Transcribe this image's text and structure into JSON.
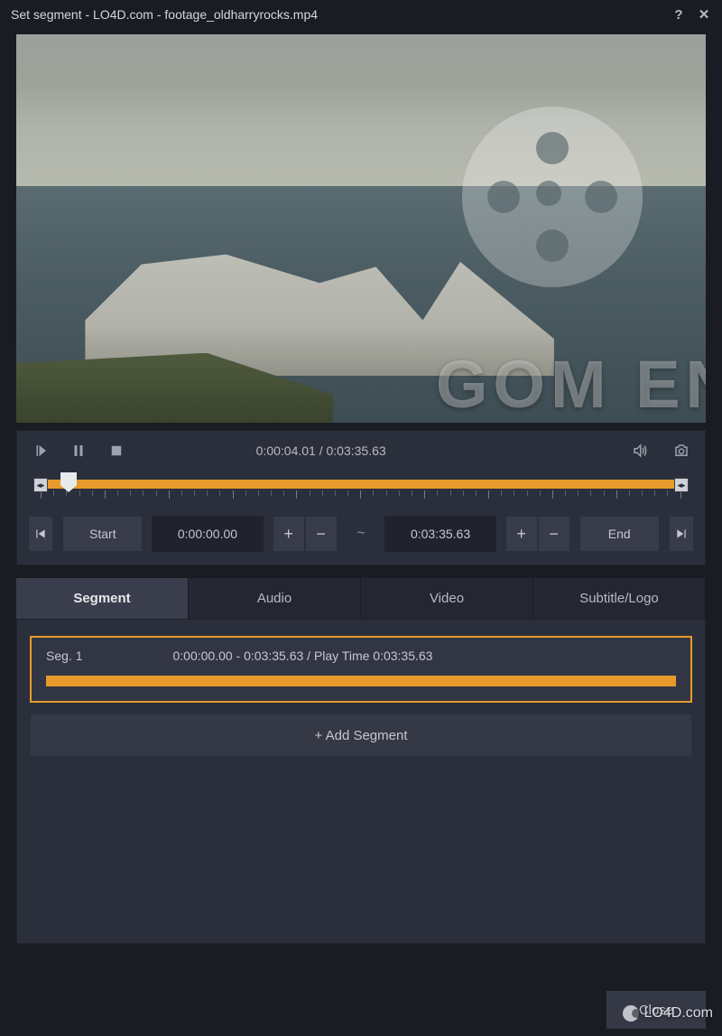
{
  "titlebar": {
    "title": "Set segment - LO4D.com - footage_oldharryrocks.mp4"
  },
  "playback": {
    "current_time": "0:00:04.01",
    "total_time": "0:03:35.63",
    "separator": " / "
  },
  "range": {
    "start_label": "Start",
    "start_time": "0:00:00.00",
    "tilde": "~",
    "end_time": "0:03:35.63",
    "end_label": "End",
    "plus": "+",
    "minus": "−"
  },
  "tabs": {
    "segment": "Segment",
    "audio": "Audio",
    "video": "Video",
    "subtitle": "Subtitle/Logo"
  },
  "segment": {
    "name": "Seg. 1",
    "info": "0:00:00.00 - 0:03:35.63 / Play Time 0:03:35.63",
    "add_label": "+ Add Segment"
  },
  "footer": {
    "close": "Close"
  },
  "watermark": {
    "site": "LO4D.com",
    "product": "GOM ENCO"
  }
}
